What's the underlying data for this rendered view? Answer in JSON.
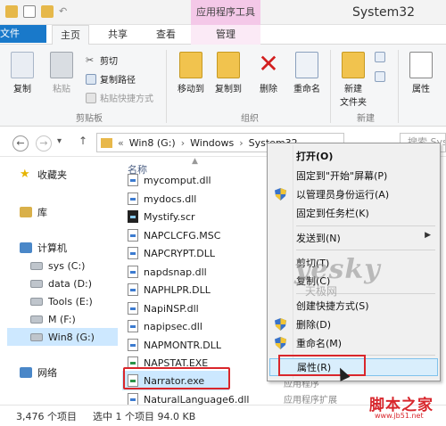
{
  "window": {
    "title": "System32",
    "context_tab_title": "应用程序工具"
  },
  "ribbon_tabs": {
    "file": "文件",
    "home": "主页",
    "share": "共享",
    "view": "查看",
    "manage": "管理"
  },
  "ribbon": {
    "clipboard": {
      "copy": "复制",
      "paste": "粘贴",
      "cut": "剪切",
      "copy_path": "复制路径",
      "paste_shortcut": "粘贴快捷方式",
      "group_label": "剪贴板"
    },
    "organize": {
      "move_to": "移动到",
      "copy_to": "复制到",
      "delete": "删除",
      "rename": "重命名",
      "group_label": "组织"
    },
    "new": {
      "new_folder_line1": "新建",
      "new_folder_line2": "文件夹",
      "group_label": "新建"
    },
    "open": {
      "properties": "属性"
    }
  },
  "address": {
    "prefix": "«",
    "crumbs": [
      "Win8 (G:)",
      "Windows",
      "System32"
    ],
    "search_placeholder": "搜索 Sys"
  },
  "nav_pane": {
    "items": [
      {
        "label": "收藏夹",
        "icon": "star-icon"
      },
      {
        "label": "库",
        "icon": "library-icon"
      },
      {
        "label": "计算机",
        "icon": "computer-icon"
      },
      {
        "label": "sys (C:)",
        "icon": "drive-icon"
      },
      {
        "label": "data (D:)",
        "icon": "drive-icon"
      },
      {
        "label": "Tools (E:)",
        "icon": "drive-icon"
      },
      {
        "label": "M (F:)",
        "icon": "drive-icon"
      },
      {
        "label": "Win8 (G:)",
        "icon": "drive-icon"
      },
      {
        "label": "网络",
        "icon": "network-icon"
      }
    ]
  },
  "file_list": {
    "column_name": "名称",
    "files": [
      "mycomput.dll",
      "mydocs.dll",
      "Mystify.scr",
      "NAPCLCFG.MSC",
      "NAPCRYPT.DLL",
      "napdsnap.dll",
      "NAPHLPR.DLL",
      "NapiNSP.dll",
      "napipsec.dll",
      "NAPMONTR.DLL",
      "NAPSTAT.EXE",
      "Narrator.exe",
      "NaturalLanguage6.dll"
    ],
    "type_fragments": [
      "应用程序",
      "应用程序扩展"
    ]
  },
  "context_menu": {
    "items": [
      "打开(O)",
      "固定到\"开始\"屏幕(P)",
      "以管理员身份运行(A)",
      "固定到任务栏(K)",
      "发送到(N)",
      "剪切(T)",
      "复制(C)",
      "创建快捷方式(S)",
      "删除(D)",
      "重命名(M)",
      "属性(R)"
    ]
  },
  "watermark": {
    "brand": "yesky",
    "sub": "天极网"
  },
  "status": {
    "count": "3,476 个项目",
    "selection": "选中 1 个项目  94.0 KB"
  },
  "site_brand": {
    "name": "脚本之家",
    "url": "www.jb51.net"
  }
}
